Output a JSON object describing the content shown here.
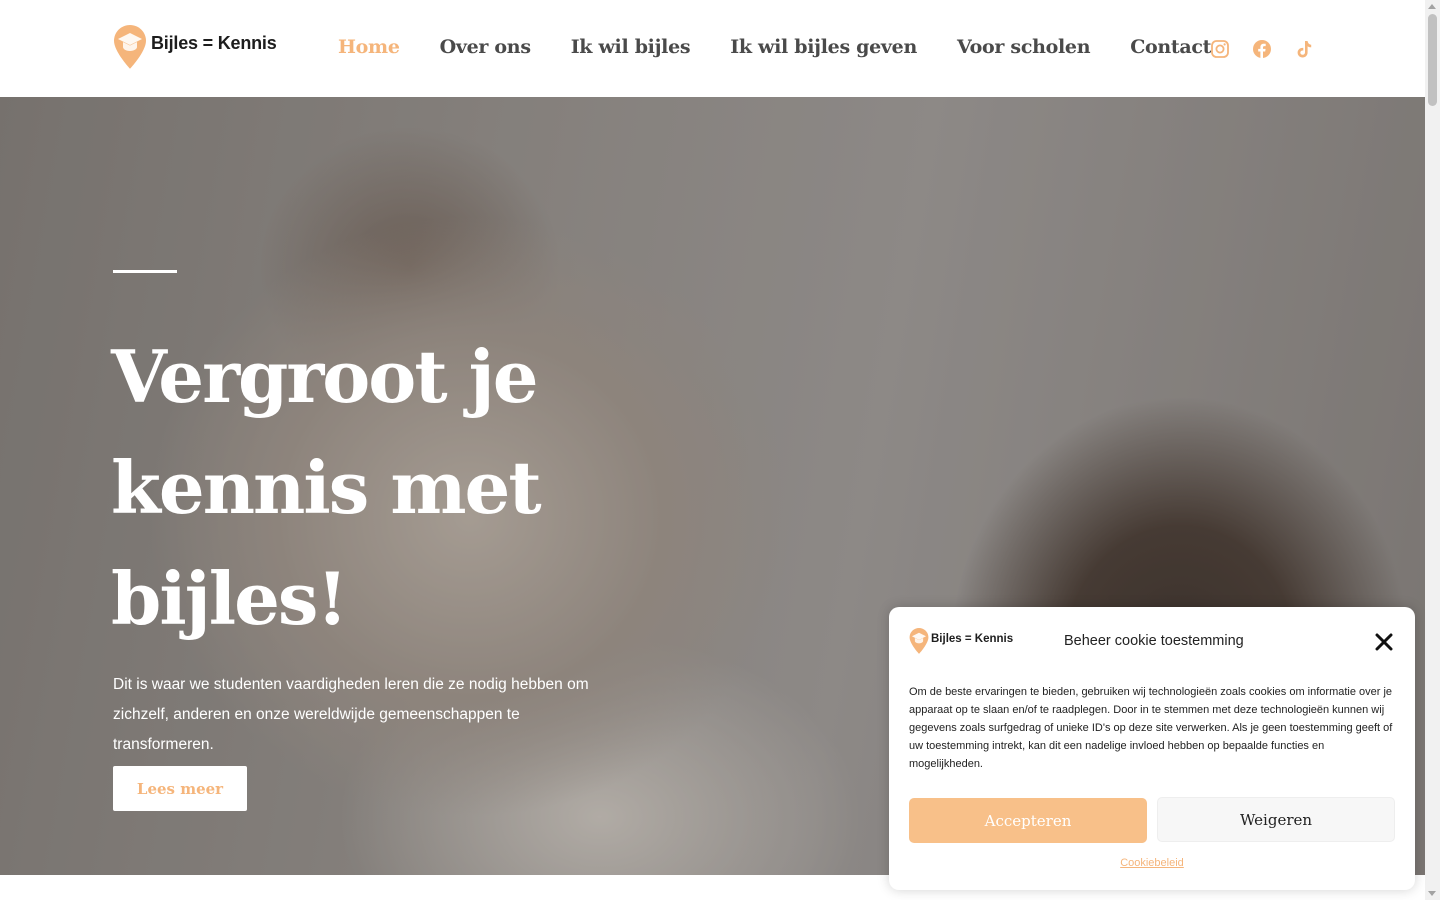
{
  "header": {
    "logo_text": "Bijles = Kennis",
    "nav": [
      "Home",
      "Over ons",
      "Ik wil bijles",
      "Ik wil bijles geven",
      "Voor scholen",
      "Contact"
    ],
    "active_nav": "Home",
    "social_icons": [
      "instagram-icon",
      "facebook-icon",
      "tiktok-icon"
    ]
  },
  "hero": {
    "title": "Vergroot je kennis met bijles!",
    "text": "Dit is waar we studenten vaardigheden leren die ze nodig hebben om zichzelf, anderen en onze wereldwijde gemeenschappen te transformeren.",
    "button": "Lees meer"
  },
  "cookie": {
    "logo_text": "Bijles = Kennis",
    "title": "Beheer cookie toestemming",
    "body": "Om de beste ervaringen te bieden, gebruiken wij technologieën zoals cookies om informatie over je apparaat op te slaan en/of te raadplegen. Door in te stemmen met deze technologieën kunnen wij gegevens zoals surfgedrag of unieke ID's op deze site verwerken. Als je geen toestemming geeft of uw toestemming intrekt, kan dit een nadelige invloed hebben op bepaalde functies en mogelijkheden.",
    "accept": "Accepteren",
    "deny": "Weigeren",
    "policy_link": "Cookiebeleid"
  },
  "colors": {
    "accent": "#f5b57b",
    "accept_button": "#f8c089",
    "nav_text": "#4a4a4a"
  }
}
